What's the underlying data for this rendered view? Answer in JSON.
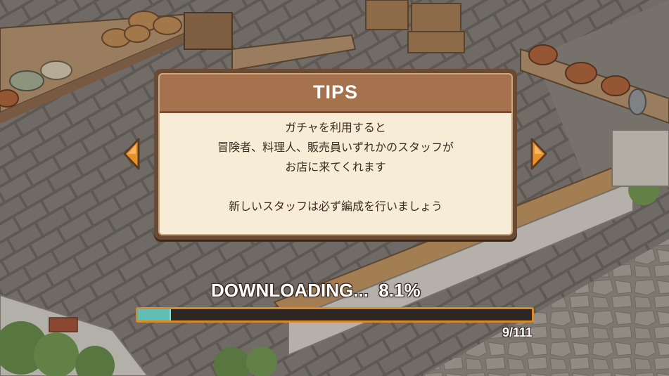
{
  "tips": {
    "title": "TIPS",
    "lines": [
      "ガチャを利用すると",
      "冒険者、料理人、販売員いずれかのスタッフが",
      "お店に来てくれます",
      "",
      "新しいスタッフは必ず編成を行いましょう"
    ]
  },
  "download": {
    "label": "DOWNLOADING...",
    "percent_text": "8.1%",
    "progress": 0.081,
    "count_text": "9/111"
  },
  "nav": {
    "prev_icon": "arrow-left-icon",
    "next_icon": "arrow-right-icon"
  },
  "colors": {
    "panel_header": "#a6714d",
    "panel_bg": "#f7ecd6",
    "arrow": "#e8902a",
    "bar_frame": "#d98b2b",
    "bar_fill": "#5fbdb3"
  }
}
